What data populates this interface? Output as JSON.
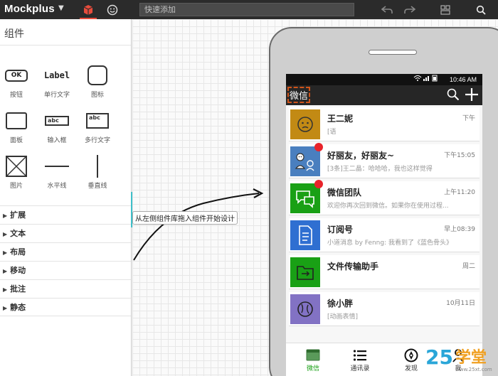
{
  "app": {
    "brand": "Mockplus",
    "quick_add_placeholder": "快速添加"
  },
  "colors": {
    "accent": "#e74c3c",
    "wechat_green": "#19a015",
    "handle": "#3fbfc9",
    "notify": "#e8232a"
  },
  "panel": {
    "title": "组件",
    "components": [
      {
        "name": "button",
        "icon_text": "OK",
        "label": "按钮"
      },
      {
        "name": "label",
        "icon_text": "Label",
        "label": "单行文字"
      },
      {
        "name": "icon",
        "icon_text": "",
        "label": "图标"
      },
      {
        "name": "panel",
        "icon_text": "",
        "label": "面板"
      },
      {
        "name": "input",
        "icon_text": "abc",
        "label": "输入框"
      },
      {
        "name": "textarea",
        "icon_text": "abc",
        "label": "多行文字"
      },
      {
        "name": "image",
        "icon_text": "",
        "label": "图片"
      },
      {
        "name": "hline",
        "icon_text": "",
        "label": "水平线"
      },
      {
        "name": "vline",
        "icon_text": "",
        "label": "垂直线"
      }
    ],
    "sections": [
      "扩展",
      "文本",
      "布局",
      "移动",
      "批注",
      "静态"
    ]
  },
  "canvas": {
    "hint": "从左侧组件库拖入组件开始设计"
  },
  "phone": {
    "status_time": "10:46 AM",
    "title": "微信",
    "chats": [
      {
        "name": "王二妮",
        "msg": "[语",
        "time": "下午",
        "avatar_color": "#c28a14",
        "avatar_icon": "face-icon",
        "unread": false
      },
      {
        "name": "好丽友，好丽友~",
        "msg": "[3条]王二晶：哈哈哈，我也这样觉得",
        "time": "下午15:05",
        "avatar_color": "#4a7fbf",
        "avatar_icon": "group-icon",
        "unread": true
      },
      {
        "name": "微信团队",
        "msg": "欢迎你再次回到微信。如果你在使用过程...",
        "time": "上午11:20",
        "avatar_color": "#19a015",
        "avatar_icon": "chat-bubbles-icon",
        "unread": true
      },
      {
        "name": "订阅号",
        "msg": "小道消息 by Fenng: 我看到了《蓝色骨头》",
        "time": "早上08:39",
        "avatar_color": "#2f6fd1",
        "avatar_icon": "document-icon",
        "unread": false
      },
      {
        "name": "文件传输助手",
        "msg": "",
        "time": "周二",
        "avatar_color": "#19a015",
        "avatar_icon": "folder-icon",
        "unread": false
      },
      {
        "name": "徐小胖",
        "msg": "[动画表情]",
        "time": "10月11日",
        "avatar_color": "#8272c4",
        "avatar_icon": "scribble-face-icon",
        "unread": false
      }
    ],
    "tabs": [
      {
        "label": "微信",
        "icon": "chat-tab-icon",
        "active": true
      },
      {
        "label": "通讯录",
        "icon": "contacts-list-icon",
        "active": false
      },
      {
        "label": "发现",
        "icon": "compass-icon",
        "active": false
      },
      {
        "label": "我",
        "icon": "person-icon",
        "active": false
      }
    ]
  },
  "watermark": {
    "text": "25学堂",
    "url": "www.25xt.com"
  }
}
